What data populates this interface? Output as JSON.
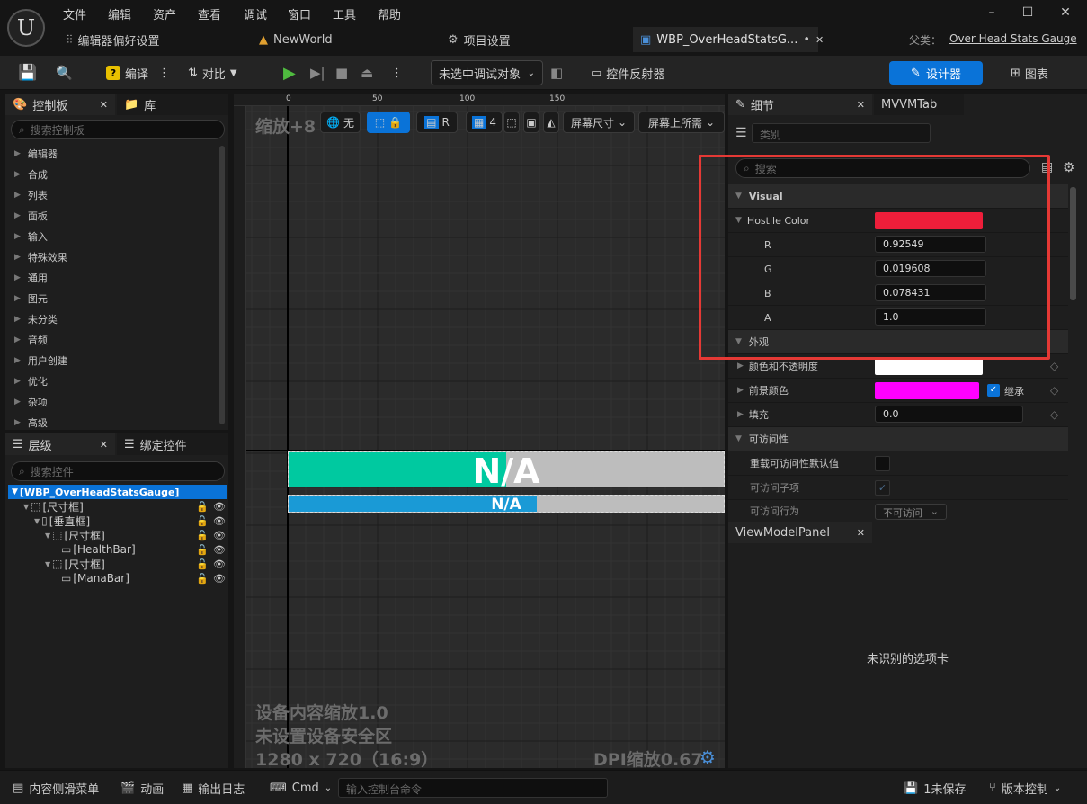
{
  "menu": [
    "文件",
    "编辑",
    "资产",
    "查看",
    "调试",
    "窗口",
    "工具",
    "帮助"
  ],
  "tabs": {
    "editor_prefs": "编辑器偏好设置",
    "new_world": "NewWorld",
    "project_settings": "项目设置",
    "active": "WBP_OverHeadStatsG...",
    "active_marker": "•"
  },
  "parent": {
    "label": "父类：",
    "value": "Over Head Stats Gauge"
  },
  "toolbar": {
    "compile": "编译",
    "diff": "对比",
    "debug_target": "未选中调试对象",
    "reflector": "控件反射器",
    "designer": "设计器",
    "graph": "图表"
  },
  "palette": {
    "tab": "控制板",
    "library_tab": "库",
    "search_placeholder": "搜索控制板",
    "categories": [
      "编辑器",
      "合成",
      "列表",
      "面板",
      "输入",
      "特殊效果",
      "通用",
      "图元",
      "未分类",
      "音频",
      "用户创建",
      "优化",
      "杂项",
      "高级"
    ]
  },
  "hierarchy": {
    "tab": "层级",
    "bind_tab": "绑定控件",
    "search_placeholder": "搜索控件",
    "root": "[WBP_OverHeadStatsGauge]",
    "nodes": [
      "[尺寸框]",
      "[垂直框]",
      "[尺寸框]",
      "[HealthBar]",
      "[尺寸框]",
      "[ManaBar]"
    ]
  },
  "viewport": {
    "zoom": "缩放+8",
    "none": "无",
    "r": "R",
    "grid_count": "4",
    "screen_size": "屏幕尺寸",
    "fill_screen": "屏幕上所需",
    "ruler": [
      "0",
      "50",
      "100",
      "150"
    ],
    "bar_text": "N/A",
    "health_fill": 0.5,
    "mana_fill": 0.57,
    "scale_info": "设备内容缩放1.0",
    "safe_zone": "未设置设备安全区",
    "resolution": "1280 x 720（16:9）",
    "dpi": "DPI缩放0.67"
  },
  "details": {
    "tab": "细节",
    "mvvm_tab": "MVVMTab",
    "category_placeholder": "类别",
    "search_placeholder": "搜索",
    "visual_section": "Visual",
    "hostile_color_label": "Hostile Color",
    "hostile_color": "#ee1e3a",
    "r_label": "R",
    "r": "0.92549",
    "g_label": "G",
    "g": "0.019608",
    "b_label": "B",
    "b": "0.078431",
    "a_label": "A",
    "a": "1.0",
    "appearance_section": "外观",
    "color_opacity": "颜色和不透明度",
    "foreground_color": "前景颜色",
    "inherit": "继承",
    "padding": "填充",
    "padding_value": "0.0",
    "accessibility_section": "可访问性",
    "override_access": "重载可访问性默认值",
    "access_children": "可访问子项",
    "access_behavior": "可访问行为",
    "access_behavior_value": "不可访问"
  },
  "viewmodel": {
    "tab": "ViewModelPanel",
    "message": "未识别的选项卡"
  },
  "statusbar": {
    "content_drawer": "内容侧滑菜单",
    "animation": "动画",
    "output_log": "输出日志",
    "cmd": "Cmd",
    "console_placeholder": "输入控制台命令",
    "unsaved": "1未保存",
    "source_control": "版本控制"
  },
  "colors": {
    "accent": "#0a73d8",
    "health": "#00c9a0",
    "mana": "#1a9ad6",
    "annotation": "#e53935",
    "foreground_color": "#ff00ff"
  }
}
